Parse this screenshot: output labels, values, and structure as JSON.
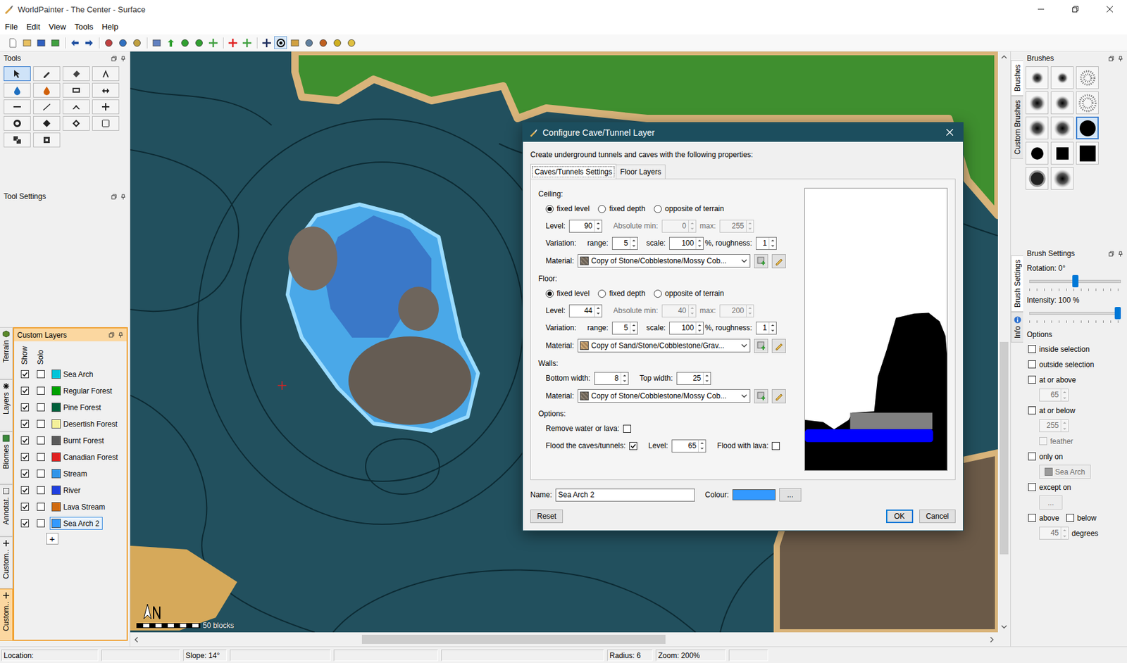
{
  "window": {
    "title": "WorldPainter - The Center - Surface"
  },
  "menu": [
    {
      "label": "File"
    },
    {
      "label": "Edit"
    },
    {
      "label": "View"
    },
    {
      "label": "Tools"
    },
    {
      "label": "Help"
    }
  ],
  "toolbar": [
    {
      "selected": false
    },
    {
      "selected": false
    },
    {
      "selected": false
    },
    {
      "selected": false
    },
    {
      "selected": false
    },
    {
      "selected": false
    },
    {
      "selected": false
    },
    {
      "selected": false
    },
    {
      "selected": false
    },
    {
      "selected": false
    },
    {
      "selected": false
    },
    {
      "selected": false
    },
    {
      "selected": false
    },
    {
      "selected": false
    },
    {
      "selected": false
    },
    {
      "selected": false
    },
    {
      "selected": false
    },
    {
      "selected": true
    },
    {
      "selected": false
    },
    {
      "selected": false
    },
    {
      "selected": false
    },
    {
      "selected": false
    },
    {
      "selected": false
    }
  ],
  "tools": {
    "title": "Tools",
    "items": [
      {
        "selected": true
      },
      {
        "selected": false
      },
      {
        "selected": false
      },
      {
        "selected": false
      },
      {
        "selected": false
      },
      {
        "selected": false
      },
      {
        "selected": false
      },
      {
        "selected": false
      },
      {
        "selected": false
      },
      {
        "selected": false
      },
      {
        "selected": false
      },
      {
        "selected": false
      },
      {
        "selected": false
      },
      {
        "selected": false
      },
      {
        "selected": false
      },
      {
        "selected": false
      },
      {
        "selected": false
      },
      {
        "selected": false
      }
    ]
  },
  "tool_settings": {
    "title": "Tool Settings"
  },
  "left_tabs": [
    {
      "label": "Terrain",
      "selected": false
    },
    {
      "label": "Layers",
      "selected": false
    },
    {
      "label": "Biomes",
      "selected": false
    },
    {
      "label": "Annotat.",
      "selected": false
    },
    {
      "label": "Custom..",
      "selected": false
    },
    {
      "label": "Custom..",
      "selected": true
    }
  ],
  "custom_layers": {
    "title": "Custom Layers",
    "columns": [
      "Show",
      "Solo"
    ],
    "add": "+",
    "rows": [
      {
        "name": "Sea Arch",
        "show": true,
        "solo": false,
        "color": "#00c4d8",
        "selected": false
      },
      {
        "name": "Regular Forest",
        "show": true,
        "solo": false,
        "color": "#00a000",
        "selected": false
      },
      {
        "name": "Pine Forest",
        "show": true,
        "solo": false,
        "color": "#00603a",
        "selected": false
      },
      {
        "name": "Desertish Forest",
        "show": true,
        "solo": false,
        "color": "#f4f09a",
        "selected": false
      },
      {
        "name": "Burnt Forest",
        "show": true,
        "solo": false,
        "color": "#5a5a5a",
        "selected": false
      },
      {
        "name": "Canadian Forest",
        "show": true,
        "solo": false,
        "color": "#e02020",
        "selected": false
      },
      {
        "name": "Stream",
        "show": true,
        "solo": false,
        "color": "#3094e8",
        "selected": false
      },
      {
        "name": "River",
        "show": true,
        "solo": false,
        "color": "#2040e0",
        "selected": false
      },
      {
        "name": "Lava Stream",
        "show": true,
        "solo": false,
        "color": "#d06a10",
        "selected": false
      },
      {
        "name": "Sea Arch 2",
        "show": true,
        "solo": false,
        "color": "#3399ff",
        "selected": true
      }
    ]
  },
  "map": {
    "scale": "50 blocks",
    "hscroll": {
      "position": 0.26,
      "size": 0.36
    },
    "vscroll": {
      "position": 0.5,
      "size": 0.38
    }
  },
  "brush_tabs": [
    {
      "label": "Brushes",
      "selected": true
    },
    {
      "label": "Custom Brushes",
      "selected": false
    }
  ],
  "brushes": {
    "title": "Brushes",
    "items": [
      {
        "selected": false
      },
      {
        "selected": false
      },
      {
        "selected": false
      },
      {
        "selected": false
      },
      {
        "selected": false
      },
      {
        "selected": false
      },
      {
        "selected": false
      },
      {
        "selected": false
      },
      {
        "selected": true
      },
      {
        "selected": false
      },
      {
        "selected": false
      },
      {
        "selected": false
      },
      {
        "selected": false
      },
      {
        "selected": false
      }
    ]
  },
  "settings_tabs": [
    {
      "label": "Brush Settings",
      "selected": true
    },
    {
      "label": "Info",
      "selected": false
    }
  ],
  "brush_settings": {
    "title": "Brush Settings",
    "sliders": [
      {
        "label": "Rotation: 0°",
        "level": 0.5
      },
      {
        "label": "Intensity: 100 %",
        "level": 1
      }
    ],
    "options_title": "Options",
    "options": [
      {
        "kind": "check",
        "label": "inside selection",
        "checked": false,
        "disabled": false
      },
      {
        "kind": "check",
        "label": "outside selection",
        "checked": false,
        "disabled": false
      },
      {
        "kind": "check",
        "label": "at or above",
        "checked": false,
        "disabled": false
      },
      {
        "kind": "spinner",
        "value": "65",
        "disabled": true
      },
      {
        "kind": "check",
        "label": "at or below",
        "checked": false,
        "disabled": false
      },
      {
        "kind": "spinner",
        "value": "255",
        "disabled": true
      },
      {
        "kind": "subcheck",
        "label": "feather",
        "checked": false,
        "disabled": true
      },
      {
        "kind": "check",
        "label": "only on",
        "checked": false,
        "disabled": false
      },
      {
        "kind": "button",
        "label": "Sea Arch",
        "disabled": true
      },
      {
        "kind": "check",
        "label": "except on",
        "checked": false,
        "disabled": false
      },
      {
        "kind": "button",
        "label": "...",
        "disabled": true
      },
      {
        "kind": "pair",
        "items": [
          {
            "label": "above",
            "checked": false
          },
          {
            "label": "below",
            "checked": false
          }
        ]
      },
      {
        "kind": "spinner",
        "value": "45",
        "suffix": "degrees",
        "disabled": true
      }
    ]
  },
  "dialog": {
    "title": "Configure Cave/Tunnel Layer",
    "intro": "Create underground tunnels and caves with the following properties:",
    "tabs": [
      {
        "label": "Caves/Tunnels Settings",
        "selected": true
      },
      {
        "label": "Floor Layers",
        "selected": false
      }
    ],
    "sections": [
      {
        "title": "Ceiling:",
        "modes": [
          {
            "label": "fixed level",
            "selected": true
          },
          {
            "label": "fixed depth",
            "selected": false
          },
          {
            "label": "opposite of terrain",
            "selected": false
          }
        ],
        "level": {
          "label": "Level:",
          "value": "90"
        },
        "min": {
          "label": "Absolute min:",
          "value": "0",
          "disabled": true
        },
        "max": {
          "label": "max:",
          "value": "255",
          "disabled": true
        },
        "variation": {
          "label": "Variation:",
          "range_label": "range:",
          "range": "5",
          "scale_label": "scale:",
          "scale": "100",
          "roughness_label": "%, roughness:",
          "roughness": "1"
        },
        "material": {
          "label": "Material:",
          "value": "Copy of Stone/Cobblestone/Mossy Cob..."
        }
      },
      {
        "title": "Floor:",
        "modes": [
          {
            "label": "fixed level",
            "selected": true
          },
          {
            "label": "fixed depth",
            "selected": false
          },
          {
            "label": "opposite of terrain",
            "selected": false
          }
        ],
        "level": {
          "label": "Level:",
          "value": "44"
        },
        "min": {
          "label": "Absolute min:",
          "value": "40",
          "disabled": true
        },
        "max": {
          "label": "max:",
          "value": "200",
          "disabled": true
        },
        "variation": {
          "label": "Variation:",
          "range_label": "range:",
          "range": "5",
          "scale_label": "scale:",
          "scale": "100",
          "roughness_label": "%, roughness:",
          "roughness": "1"
        },
        "material": {
          "label": "Material:",
          "value": "Copy of Sand/Stone/Cobblestone/Grav..."
        }
      }
    ],
    "walls": {
      "title": "Walls:",
      "bottom": {
        "label": "Bottom width:",
        "value": "8"
      },
      "top": {
        "label": "Top width:",
        "value": "25"
      },
      "material": {
        "label": "Material:",
        "value": "Copy of Stone/Cobblestone/Mossy Cob..."
      }
    },
    "options": {
      "title": "Options:",
      "remove": {
        "label": "Remove water or lava:",
        "checked": false
      },
      "flood": {
        "label": "Flood the caves/tunnels:",
        "checked": true
      },
      "level": {
        "label": "Level:",
        "value": "65"
      },
      "lava": {
        "label": "Flood with lava:",
        "checked": false
      }
    },
    "name": {
      "label": "Name:",
      "value": "Sea Arch 2"
    },
    "colour": {
      "label": "Colour:",
      "value": "#3399ff",
      "button": "..."
    },
    "buttons": [
      {
        "label": "Reset",
        "default": false
      },
      {
        "label": "OK",
        "default": true
      },
      {
        "label": "Cancel",
        "default": false
      }
    ]
  },
  "status_bar": [
    {
      "text": "Location:"
    },
    {
      "text": ""
    },
    {
      "text": "Slope: 14°"
    },
    {
      "text": ""
    },
    {
      "text": ""
    },
    {
      "text": ""
    },
    {
      "text": "Radius: 6"
    },
    {
      "text": "Zoom: 200%"
    },
    {
      "text": ""
    }
  ]
}
